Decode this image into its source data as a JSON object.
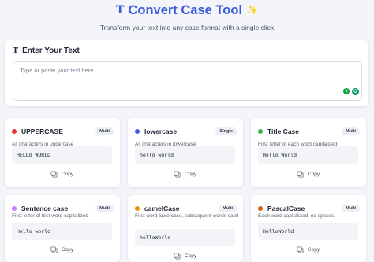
{
  "header": {
    "title": "Convert Case Tool",
    "title_icon": "text-T-icon",
    "sparkle_icon": "sparkle-icon",
    "subtitle": "Transform your text into any case format with a single click"
  },
  "input": {
    "label": "Enter Your Text",
    "placeholder": "Type or paste your text here...",
    "value": ""
  },
  "copy_label": "Copy",
  "cards": [
    {
      "name": "UPPERCASE",
      "badge": "Multi",
      "desc": "All characters in uppercase",
      "preview": "HELLO WORLD",
      "color": "#e03131"
    },
    {
      "name": "lowercase",
      "badge": "Single",
      "desc": "All characters in lowercase",
      "preview": "hello world",
      "color": "#3b5bdb"
    },
    {
      "name": "Title Case",
      "badge": "Multi",
      "desc": "First letter of each word capitalized",
      "preview": "Hello World",
      "color": "#2fb344"
    },
    {
      "name": "Sentence case",
      "badge": "Multi",
      "desc": "First letter of first word capitalized",
      "preview": "Hello world",
      "color": "#c77dff"
    },
    {
      "name": "camelCase",
      "badge": "Multi",
      "desc": "First word lowercase, subsequent words capitalized",
      "preview": "helloWorld",
      "color": "#f08c00"
    },
    {
      "name": "PascalCase",
      "badge": "Multi",
      "desc": "Each word capitalized, no spaces",
      "preview": "HelloWorld",
      "color": "#e8590c"
    }
  ],
  "colors": {
    "accent": "#3b5bdb",
    "background": "#f3f5fa"
  }
}
